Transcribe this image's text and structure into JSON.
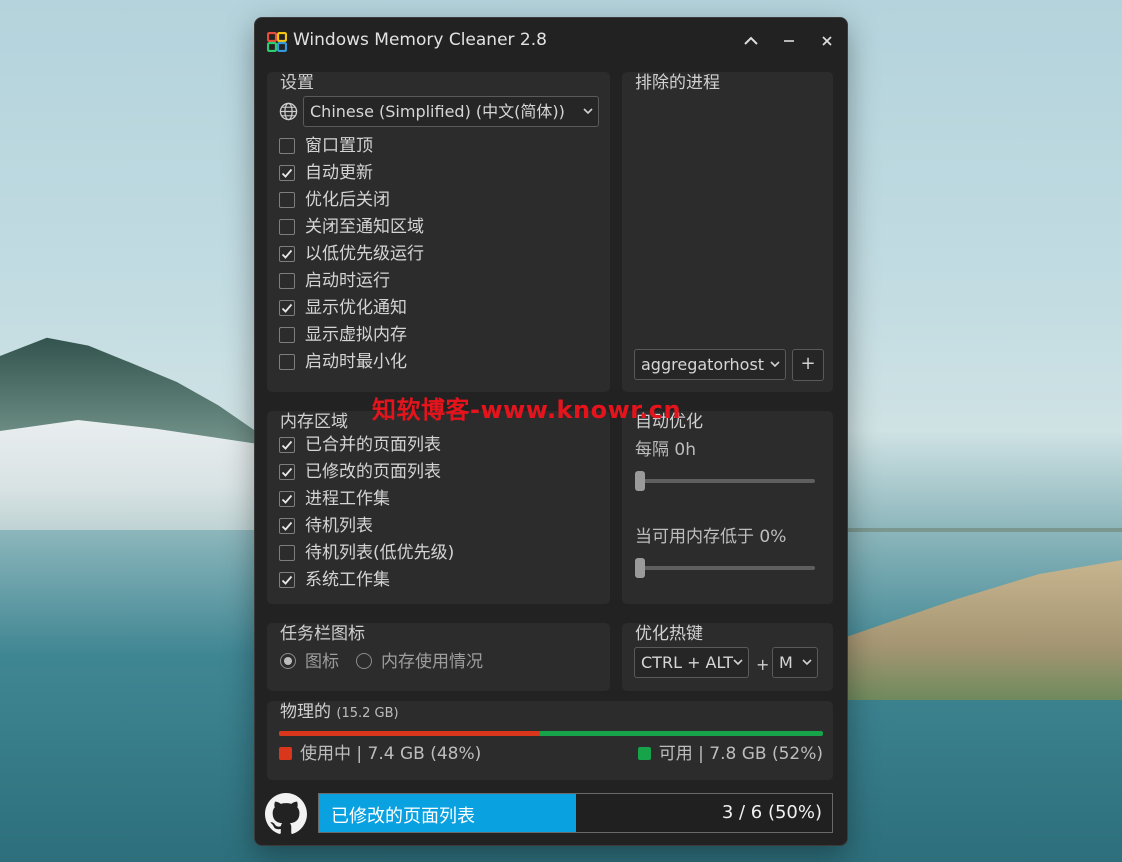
{
  "window": {
    "title": "Windows Memory Cleaner 2.8"
  },
  "settings": {
    "title": "设置",
    "language": "Chinese (Simplified) (中文(简体))",
    "options": [
      {
        "label": "窗口置顶",
        "checked": false
      },
      {
        "label": "自动更新",
        "checked": true
      },
      {
        "label": "优化后关闭",
        "checked": false
      },
      {
        "label": "关闭至通知区域",
        "checked": false
      },
      {
        "label": "以低优先级运行",
        "checked": true
      },
      {
        "label": "启动时运行",
        "checked": false
      },
      {
        "label": "显示优化通知",
        "checked": true
      },
      {
        "label": "显示虚拟内存",
        "checked": false
      },
      {
        "label": "启动时最小化",
        "checked": false
      }
    ]
  },
  "excluded": {
    "title": "排除的进程",
    "selected_process": "aggregatorhost",
    "add_label": "+"
  },
  "memory_areas": {
    "title": "内存区域",
    "options": [
      {
        "label": "已合并的页面列表",
        "checked": true
      },
      {
        "label": "已修改的页面列表",
        "checked": true
      },
      {
        "label": "进程工作集",
        "checked": true
      },
      {
        "label": "待机列表",
        "checked": true
      },
      {
        "label": "待机列表(低优先级)",
        "checked": false
      },
      {
        "label": "系统工作集",
        "checked": true
      }
    ]
  },
  "auto_optimize": {
    "title": "自动优化",
    "interval_label": "每隔 0h",
    "interval_value": 0,
    "threshold_label": "当可用内存低于 0%",
    "threshold_value": 0
  },
  "tray_icon": {
    "title": "任务栏图标",
    "options": [
      {
        "label": "图标",
        "selected": true
      },
      {
        "label": "内存使用情况",
        "selected": false
      }
    ]
  },
  "hotkey": {
    "title": "优化热键",
    "modifier": "CTRL + ALT",
    "plus": "+",
    "key": "M"
  },
  "physical": {
    "title": "物理的",
    "total": "(15.2 GB)",
    "used_label": "使用中 | 7.4 GB (48%)",
    "free_label": "可用 | 7.8 GB (52%)",
    "used_fraction": 0.48,
    "colors": {
      "used": "#d9361c",
      "free": "#16a34a"
    }
  },
  "status": {
    "label": "已修改的页面列表",
    "count": "3 / 6 (50%)",
    "fraction": 0.5,
    "color": "#0aa1e0"
  },
  "watermark": "知软博客-www.knowr.cn"
}
